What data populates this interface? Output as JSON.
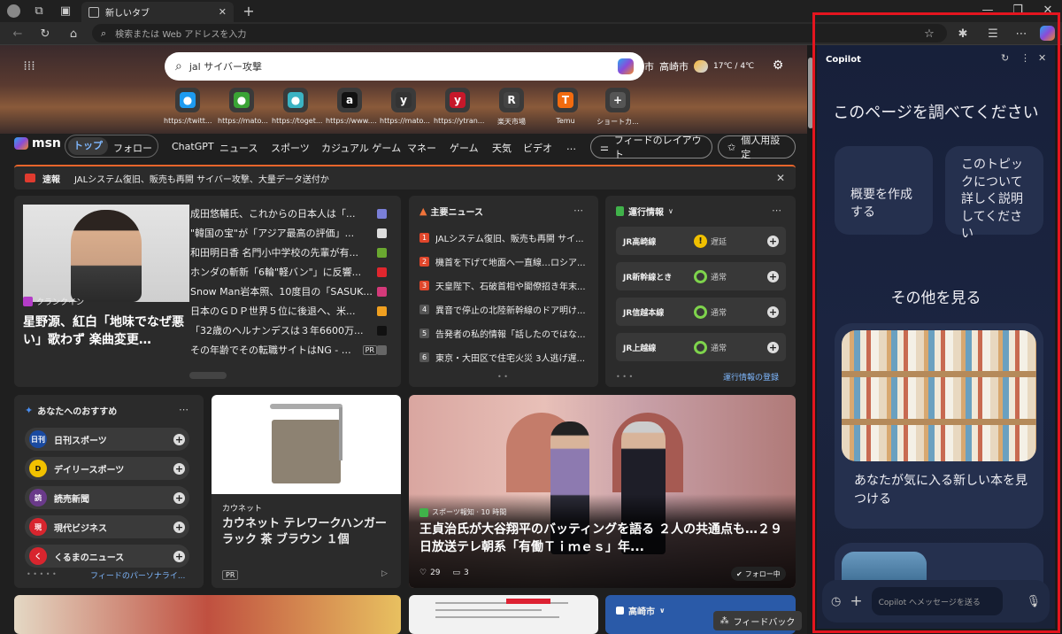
{
  "browser": {
    "tab_title": "新しいタブ",
    "address_placeholder": "検索または Web アドレスを入力"
  },
  "msn_header": {
    "search_value": "jal サイバー攻撃",
    "location": "高崎市",
    "temp": "17℃ / 4℃",
    "brand": "msn"
  },
  "quick_links": [
    {
      "label": "https://twitt...",
      "icon": "twitter-bird-icon",
      "color": "#1d9bf0",
      "glyph": "●"
    },
    {
      "label": "https://mato...",
      "icon": "green-leaf-icon",
      "color": "#3aa335",
      "glyph": "●"
    },
    {
      "label": "https://toget...",
      "icon": "togetter-icon",
      "color": "#3bb3c3",
      "glyph": "●"
    },
    {
      "label": "https://www....",
      "icon": "amazon-icon",
      "color": "#111111",
      "glyph": "a"
    },
    {
      "label": "https://mato...",
      "icon": "matome-icon",
      "color": "#333333",
      "glyph": "y"
    },
    {
      "label": "https://ytran...",
      "icon": "ytran-icon",
      "color": "#c7182a",
      "glyph": "y"
    },
    {
      "label": "楽天市場",
      "icon": "rakuten-icon",
      "color": "#444444",
      "glyph": "R"
    },
    {
      "label": "Temu",
      "icon": "temu-icon",
      "color": "#f26b0f",
      "glyph": "T"
    },
    {
      "label": "ショートカ...",
      "icon": "add-shortcut-icon",
      "color": "#555555",
      "glyph": "+"
    }
  ],
  "nav": {
    "items": [
      "トップ",
      "フォロー",
      "ChatGPT",
      "ニュース",
      "スポーツ",
      "カジュアル ゲーム",
      "マネー",
      "ゲーム",
      "天気",
      "ビデオ",
      "…"
    ],
    "feed_layout": "フィードのレイアウト",
    "personal": "個人用設定"
  },
  "breaking": {
    "tag": "速報",
    "text": "JALシステム復旧、販売も再開 サイバー攻撃、大量データ送付か"
  },
  "headline": {
    "source": "クランクイン",
    "title": "星野源、紅白「地味でなぜ悪い」歌わず 楽曲変更…"
  },
  "headline_list": [
    {
      "text": "成田悠輔氏、これからの日本人は「...",
      "color": "#7a7fd8"
    },
    {
      "text": "\"韓国の宝\"が「アジア最高の評価」...",
      "color": "#dddddd"
    },
    {
      "text": "和田明日香 名門小中学校の先輩が有...",
      "color": "#6aa830"
    },
    {
      "text": "ホンダの斬新「6輪\"軽バン\"」に反響...",
      "color": "#e0262e"
    },
    {
      "text": "Snow Man岩本照、10度目の「SASUK...",
      "color": "#d43a7a"
    },
    {
      "text": "日本のＧＤＰ世界５位に後退へ、米...",
      "color": "#f0a020"
    },
    {
      "text": "「32歳のヘルナンデスは３年6600万...",
      "color": "#111111"
    },
    {
      "text": "その年齢でその転職サイトはNG - 仕...",
      "color": "#666666",
      "pr": "PR"
    }
  ],
  "main_news": {
    "title": "主要ニュース",
    "items": [
      {
        "rank": "1",
        "text": "JALシステム復旧、販売も再開 サイ..."
      },
      {
        "rank": "2",
        "text": "機首を下げて地面へ一直線…ロシア..."
      },
      {
        "rank": "3",
        "text": "天皇陛下、石破首相や閣僚招き年末..."
      },
      {
        "rank": "4",
        "text": "異音で停止の北陸新幹線のドア明け..."
      },
      {
        "rank": "5",
        "text": "告発者の私的情報「話したのではな..."
      },
      {
        "rank": "6",
        "text": "東京・大田区で住宅火災 3人逃げ遅..."
      }
    ]
  },
  "train": {
    "title": "運行情報",
    "lines": [
      {
        "name": "JR高崎線",
        "status": "遅延",
        "kind": "delay"
      },
      {
        "name": "JR新幹線とき",
        "status": "通常",
        "kind": "ok"
      },
      {
        "name": "JR信越本線",
        "status": "通常",
        "kind": "ok"
      },
      {
        "name": "JR上越線",
        "status": "通常",
        "kind": "ok"
      }
    ],
    "register": "運行情報の登録"
  },
  "recommend": {
    "title": "あなたへのおすすめ",
    "items": [
      {
        "name": "日刊スポーツ",
        "badge": "日刊",
        "bg": "#1a4aa0",
        "fg": "#ffffff"
      },
      {
        "name": "デイリースポーツ",
        "badge": "D",
        "bg": "#f2c200",
        "fg": "#111111"
      },
      {
        "name": "読売新聞",
        "badge": "読",
        "bg": "#6a3a8a",
        "fg": "#ffffff"
      },
      {
        "name": "現代ビジネス",
        "badge": "現",
        "bg": "#d8252e",
        "fg": "#ffffff"
      },
      {
        "name": "くるまのニュース",
        "badge": "く",
        "bg": "#d8252e",
        "fg": "#ffffff"
      }
    ],
    "more": "フィードのパーソナライ..."
  },
  "ad": {
    "source": "カウネット",
    "title": "カウネット テレワークハンガーラック 茶 ブラウン １個",
    "pr": "PR"
  },
  "feature": {
    "source": "スポーツ報知 · 10 時間",
    "title": "王貞治氏が大谷翔平のバッティングを語る ２人の共通点も…２９日放送テレ朝系「有働Ｔｉｍｅｓ」年...",
    "likes": "29",
    "comments": "3",
    "follow": "フォロー中"
  },
  "weather_mini": {
    "location": "高崎市"
  },
  "feedback": "フィードバック",
  "copilot": {
    "title": "Copilot",
    "heading": "このページを調べてください",
    "btn1": "概要を作成する",
    "btn2": "このトピックについて詳しく説明してください",
    "see_more": "その他を見る",
    "book_card": "あなたが気に入る新しい本を見つける",
    "input_placeholder": "Copilot へメッセージを送る"
  }
}
